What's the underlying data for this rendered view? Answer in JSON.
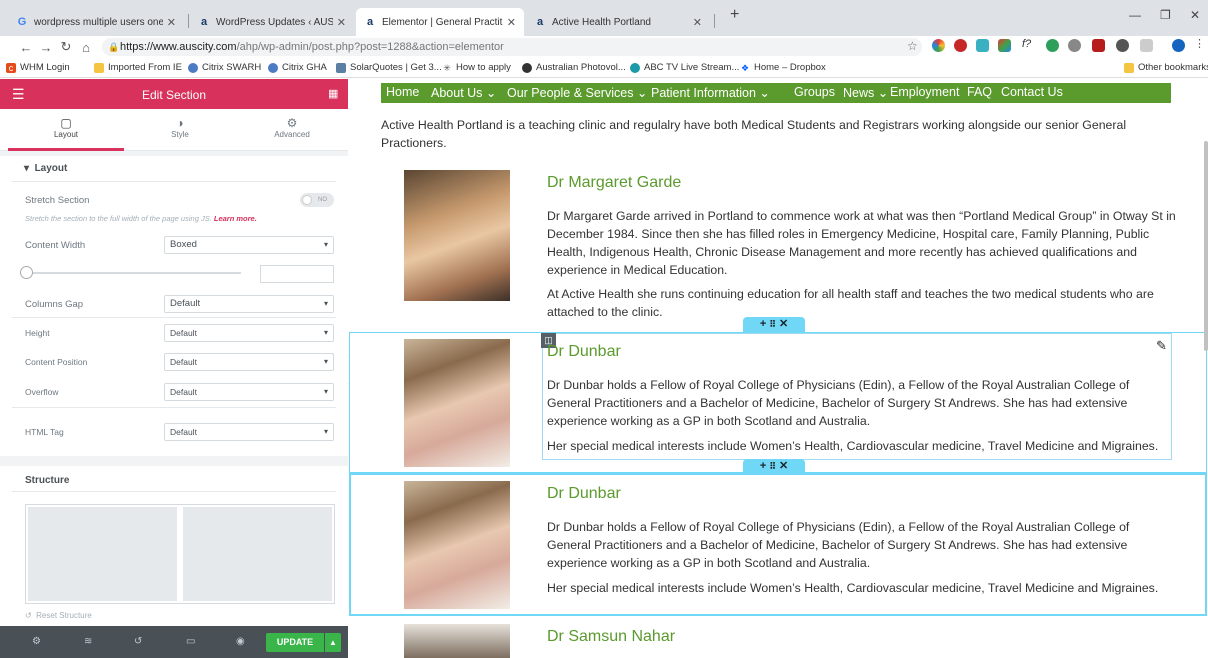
{
  "browser": {
    "tabs": [
      {
        "favicon": "google-g",
        "title": "wordpress multiple users one ac"
      },
      {
        "favicon": "auscity-a",
        "title": "WordPress Updates ‹ AUSCITY.C"
      },
      {
        "favicon": "auscity-a",
        "title": "Elementor | General Practitioners"
      },
      {
        "favicon": "auscity-a",
        "title": "Active Health Portland"
      }
    ],
    "url_host": "https://www.auscity.com",
    "url_path": "/ahp/wp-admin/post.php?post=1288&action=elementor",
    "bookmarks": [
      "WHM Login",
      "Imported From IE",
      "Citrix SWARH",
      "Citrix GHA",
      "SolarQuotes | Get 3...",
      "How to apply",
      "Australian Photovol...",
      "ABC TV Live Stream...",
      "Home – Dropbox"
    ],
    "other_bookmarks": "Other bookmarks"
  },
  "panel": {
    "title": "Edit Section",
    "tabs": [
      "Layout",
      "Style",
      "Advanced"
    ],
    "layout_heading": "Layout",
    "stretch_label": "Stretch Section",
    "stretch_toggle": "NO",
    "stretch_help": "Stretch the section to the full width of the page using JS.",
    "learn_more": "Learn more.",
    "content_width_label": "Content Width",
    "content_width_value": "Boxed",
    "columns_gap_label": "Columns Gap",
    "columns_gap_value": "Default",
    "height_label": "Height",
    "height_value": "Default",
    "content_position_label": "Content Position",
    "content_position_value": "Default",
    "overflow_label": "Overflow",
    "overflow_value": "Default",
    "html_tag_label": "HTML Tag",
    "html_tag_value": "Default",
    "structure_heading": "Structure",
    "reset_structure": "Reset Structure",
    "update_label": "UPDATE"
  },
  "site": {
    "nav": [
      "Home",
      "About Us ⌄",
      "Our People & Services ⌄",
      "Patient Information ⌄",
      "Groups",
      "News ⌄",
      "Employment",
      "FAQ",
      "Contact Us"
    ],
    "intro": "Active Health Portland is a teaching clinic and regulalry have both Medical Students and Registrars working alongside our senior General Practioners.",
    "doctors": [
      {
        "name": "Dr Margaret Garde",
        "p1": "Dr Margaret Garde arrived in Portland to commence work at what was then “Portland Medical Group” in Otway St in December 1984. Since then she has filled roles in Emergency Medicine, Hospital care, Family Planning, Public Health, Indigenous Health, Chronic Disease Management and more recently has achieved qualifications and experience in Medical Education.",
        "p2": "At Active Health she runs continuing education for all health staff and teaches the two medical students who are attached to the clinic."
      },
      {
        "name": "Dr Dunbar",
        "p1": "Dr Dunbar holds a Fellow of Royal College of Physicians (Edin), a Fellow of the Royal Australian College of General Practitioners and a Bachelor of Medicine, Bachelor of Surgery St Andrews. She has had extensive experience working as a GP in both Scotland and Australia.",
        "p2": "Her special medical interests include Women’s Health, Cardiovascular medicine, Travel Medicine and Migraines."
      },
      {
        "name": "Dr Dunbar",
        "p1": "Dr Dunbar holds a Fellow of Royal College of Physicians (Edin), a Fellow of the Royal Australian College of General Practitioners and a Bachelor of Medicine, Bachelor of Surgery St Andrews. She has had extensive experience working as a GP in both Scotland and Australia.",
        "p2": "Her special medical interests include Women’s Health, Cardiovascular medicine, Travel Medicine and Migraines."
      },
      {
        "name": "Dr Samsun Nahar"
      }
    ]
  },
  "colors": {
    "elementor_pink": "#d8315b",
    "nav_green": "#5b9a2d",
    "selection_blue": "#71d7f7",
    "update_green": "#39b54a"
  }
}
